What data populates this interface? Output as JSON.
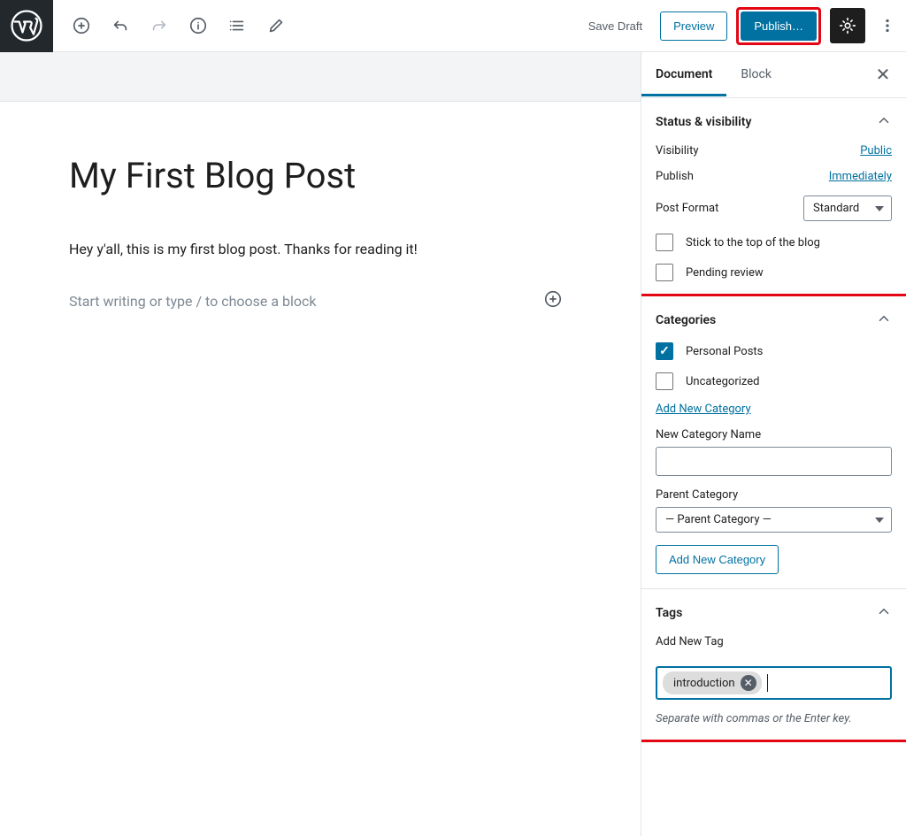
{
  "topbar": {
    "save_draft": "Save Draft",
    "preview": "Preview",
    "publish": "Publish…"
  },
  "editor": {
    "title": "My First Blog Post",
    "body": "Hey y'all, this is my first blog post. Thanks for reading it!",
    "placeholder": "Start writing or type / to choose a block"
  },
  "sidebar": {
    "tabs": {
      "document": "Document",
      "block": "Block"
    },
    "status": {
      "header": "Status & visibility",
      "visibility_label": "Visibility",
      "visibility_value": "Public",
      "publish_label": "Publish",
      "publish_value": "Immediately",
      "post_format_label": "Post Format",
      "post_format_value": "Standard",
      "stick_label": "Stick to the top of the blog",
      "pending_label": "Pending review"
    },
    "categories": {
      "header": "Categories",
      "items": [
        {
          "label": "Personal Posts",
          "checked": true
        },
        {
          "label": "Uncategorized",
          "checked": false
        }
      ],
      "add_link": "Add New Category",
      "new_name_label": "New Category Name",
      "parent_label": "Parent Category",
      "parent_value": "— Parent Category —",
      "add_button": "Add New Category"
    },
    "tags": {
      "header": "Tags",
      "add_label": "Add New Tag",
      "chip": "introduction",
      "helper": "Separate with commas or the Enter key."
    }
  }
}
